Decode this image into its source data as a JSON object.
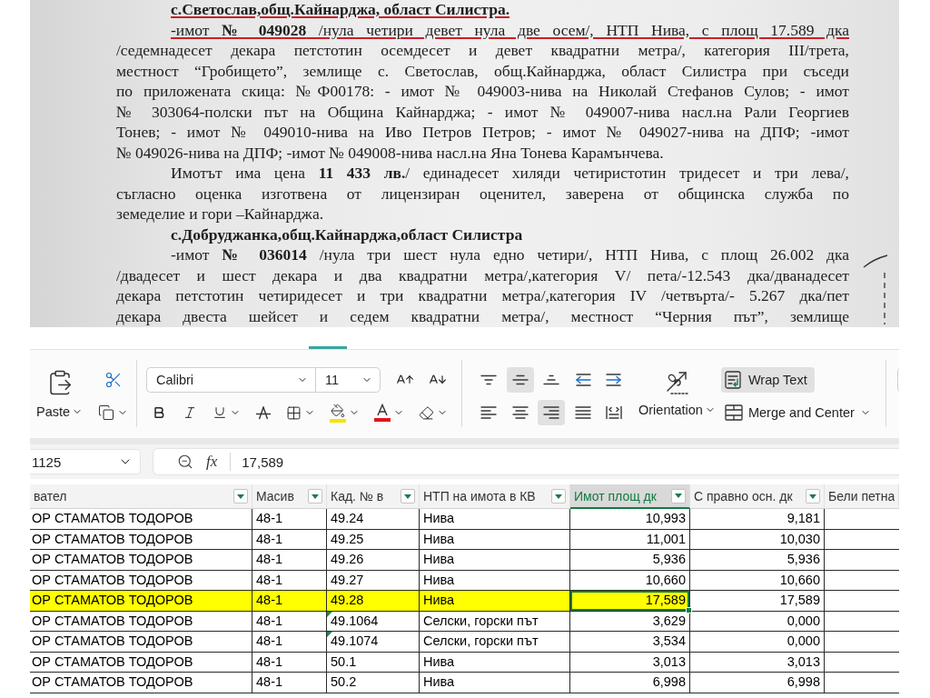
{
  "document": {
    "lines": [
      {
        "kind": "heading",
        "text": "с.Светослав,общ.Кайнарджа, област Силистра.",
        "underlined": true
      },
      {
        "kind": "first",
        "text": "-имот **№ 049028** /нула четири девет нула две осем/, НТП Нива, с площ 17.589 дка",
        "underlined": true
      },
      {
        "kind": "body",
        "text": "/седемнадесет декара петстотин осемдесет и девет квадратни метра/, категория III/трета,",
        "underlined": false
      },
      {
        "kind": "body",
        "text": "местност “Гробището”, землище с. Светослав, общ.Кайнарджа, област Силистра при съседи",
        "underlined": false
      },
      {
        "kind": "body",
        "text": "по приложената скица: №Ф00178: - имот № 049003-нива на Николай Стефанов Сулов; - имот",
        "underlined": false
      },
      {
        "kind": "body",
        "text": "№ 303064-полски път на Община Кайнарджа; - имот № 049007-нива насл.на Рали Георгиев",
        "underlined": false
      },
      {
        "kind": "body",
        "text": "Тонев; - имот № 049010-нива на Иво Петров Петров; - имот № 049027-нива на ДПФ; -имот",
        "underlined": false
      },
      {
        "kind": "last",
        "text": "№ 049026-нива на ДПФ; -имот № 049008-нива насл.на Яна Тонева Карамънчева.",
        "underlined": false
      },
      {
        "kind": "first",
        "text": "Имотът има цена **11 433 лв.**/ единадесет хиляди четиристотин тридесет и три лева/,",
        "underlined": false
      },
      {
        "kind": "body",
        "text": "съгласно оценка изготвена от лицензиран оценител, заверена от общинска служба по",
        "underlined": false
      },
      {
        "kind": "last",
        "text": "земеделие и гори –Кайнарджа.",
        "underlined": false
      },
      {
        "kind": "heading",
        "text": "с.Добруджанка,общ.Кайнарджа,област Силистра",
        "underlined": false
      },
      {
        "kind": "first",
        "text": "-имот **№ 036014** /нула три шест нула едно четири/, НТП Нива, с площ 26.002 дка",
        "underlined": false
      },
      {
        "kind": "body",
        "text": "/двадесет и шест декара и два квадратни метра/,категория V/ пета/-12.543 дка/дванадесет",
        "underlined": false
      },
      {
        "kind": "body",
        "text": "декара петстотин четиридесет и три квадратни метра/,категория IV /четвърта/- 5.267 дка/пет",
        "underlined": false
      },
      {
        "kind": "body",
        "text": "декара двеста шейсет и седем квадратни метра/, местност “Черния път”, землище",
        "underlined": false
      }
    ]
  },
  "ribbon": {
    "paste": {
      "label": "Paste"
    },
    "font": {
      "name": "Calibri",
      "size": "11"
    },
    "alignment": [
      {
        "kind": "top",
        "selected": false
      },
      {
        "kind": "middle",
        "selected": true
      },
      {
        "kind": "bottom",
        "selected": false
      },
      {
        "kind": "outdent",
        "selected": false
      },
      {
        "kind": "indent",
        "selected": false
      },
      {
        "kind": "left",
        "selected": false
      },
      {
        "kind": "center",
        "selected": false
      },
      {
        "kind": "right",
        "selected": true
      },
      {
        "kind": "justify",
        "selected": false
      },
      {
        "kind": "distributed",
        "selected": false
      }
    ],
    "orientation": {
      "label": "Orientation"
    },
    "wrap_text": {
      "label": "Wrap Text",
      "selected": true
    },
    "merge": {
      "label": "Merge and Center"
    }
  },
  "formula_bar": {
    "name_box": "1125",
    "function_button": "fx",
    "value": "17,589"
  },
  "table": {
    "columns": [
      {
        "label": "вател",
        "kind": "text",
        "filter": true,
        "selected": false
      },
      {
        "label": "Масив",
        "kind": "text",
        "filter": true,
        "selected": false
      },
      {
        "label": "Кад. № в",
        "kind": "text",
        "filter": true,
        "selected": false
      },
      {
        "label": "НТП на имота в КВ",
        "kind": "text",
        "filter": true,
        "selected": false
      },
      {
        "label": "Имот площ дк",
        "kind": "number",
        "filter": true,
        "selected": true
      },
      {
        "label": "С правно осн. дк",
        "kind": "number",
        "filter": true,
        "selected": false
      },
      {
        "label": "Бели петна",
        "filter": false,
        "selected": false
      }
    ],
    "rows": [
      {
        "cells": [
          {
            "text": "ОР СТАМАТОВ ТОДОРОВ",
            "highlighted": false,
            "flagged": false,
            "selected": false
          },
          {
            "text": "48-1",
            "highlighted": false,
            "flagged": false,
            "selected": false
          },
          {
            "text": "49.24",
            "highlighted": false,
            "flagged": false,
            "selected": false
          },
          {
            "text": "Нива",
            "highlighted": false,
            "flagged": false,
            "selected": false
          },
          {
            "text": "10,993",
            "highlighted": false,
            "flagged": false,
            "selected": false
          },
          {
            "text": "9,181",
            "highlighted": false,
            "flagged": false,
            "selected": false
          }
        ]
      },
      {
        "cells": [
          {
            "text": "ОР СТАМАТОВ ТОДОРОВ",
            "highlighted": false,
            "flagged": false,
            "selected": false
          },
          {
            "text": "48-1",
            "highlighted": false,
            "flagged": false,
            "selected": false
          },
          {
            "text": "49.25",
            "highlighted": false,
            "flagged": false,
            "selected": false
          },
          {
            "text": "Нива",
            "highlighted": false,
            "flagged": false,
            "selected": false
          },
          {
            "text": "11,001",
            "highlighted": false,
            "flagged": false,
            "selected": false
          },
          {
            "text": "10,030",
            "highlighted": false,
            "flagged": false,
            "selected": false
          }
        ]
      },
      {
        "cells": [
          {
            "text": "ОР СТАМАТОВ ТОДОРОВ",
            "highlighted": false,
            "flagged": false,
            "selected": false
          },
          {
            "text": "48-1",
            "highlighted": false,
            "flagged": false,
            "selected": false
          },
          {
            "text": "49.26",
            "highlighted": false,
            "flagged": false,
            "selected": false
          },
          {
            "text": "Нива",
            "highlighted": false,
            "flagged": false,
            "selected": false
          },
          {
            "text": "5,936",
            "highlighted": false,
            "flagged": false,
            "selected": false
          },
          {
            "text": "5,936",
            "highlighted": false,
            "flagged": false,
            "selected": false
          }
        ]
      },
      {
        "cells": [
          {
            "text": "ОР СТАМАТОВ ТОДОРОВ",
            "highlighted": false,
            "flagged": false,
            "selected": false
          },
          {
            "text": "48-1",
            "highlighted": false,
            "flagged": false,
            "selected": false
          },
          {
            "text": "49.27",
            "highlighted": false,
            "flagged": false,
            "selected": false
          },
          {
            "text": "Нива",
            "highlighted": false,
            "flagged": false,
            "selected": false
          },
          {
            "text": "10,660",
            "highlighted": false,
            "flagged": false,
            "selected": false
          },
          {
            "text": "10,660",
            "highlighted": false,
            "flagged": false,
            "selected": false
          }
        ]
      },
      {
        "cells": [
          {
            "text": "ОР СТАМАТОВ ТОДОРОВ",
            "highlighted": true,
            "flagged": false,
            "selected": false
          },
          {
            "text": "48-1",
            "highlighted": true,
            "flagged": false,
            "selected": false
          },
          {
            "text": "49.28",
            "highlighted": true,
            "flagged": false,
            "selected": false
          },
          {
            "text": "Нива",
            "highlighted": true,
            "flagged": false,
            "selected": false
          },
          {
            "text": "17,589",
            "highlighted": true,
            "flagged": false,
            "selected": true
          },
          {
            "text": "17,589",
            "highlighted": false,
            "flagged": false,
            "selected": false
          }
        ]
      },
      {
        "cells": [
          {
            "text": "ОР СТАМАТОВ ТОДОРОВ",
            "highlighted": false,
            "flagged": false,
            "selected": false
          },
          {
            "text": "48-1",
            "highlighted": false,
            "flagged": false,
            "selected": false
          },
          {
            "text": "49.1064",
            "highlighted": false,
            "flagged": true,
            "selected": false
          },
          {
            "text": "Селски, горски път",
            "highlighted": false,
            "flagged": false,
            "selected": false
          },
          {
            "text": "3,629",
            "highlighted": false,
            "flagged": false,
            "selected": false
          },
          {
            "text": "0,000",
            "highlighted": false,
            "flagged": false,
            "selected": false
          }
        ]
      },
      {
        "cells": [
          {
            "text": "ОР СТАМАТОВ ТОДОРОВ",
            "highlighted": false,
            "flagged": false,
            "selected": false
          },
          {
            "text": "48-1",
            "highlighted": false,
            "flagged": false,
            "selected": false
          },
          {
            "text": "49.1074",
            "highlighted": false,
            "flagged": true,
            "selected": false
          },
          {
            "text": "Селски, горски път",
            "highlighted": false,
            "flagged": false,
            "selected": false
          },
          {
            "text": "3,534",
            "highlighted": false,
            "flagged": false,
            "selected": false
          },
          {
            "text": "0,000",
            "highlighted": false,
            "flagged": false,
            "selected": false
          }
        ]
      },
      {
        "cells": [
          {
            "text": "ОР СТАМАТОВ ТОДОРОВ",
            "highlighted": false,
            "flagged": false,
            "selected": false
          },
          {
            "text": "48-1",
            "highlighted": false,
            "flagged": false,
            "selected": false
          },
          {
            "text": "50.1",
            "highlighted": false,
            "flagged": false,
            "selected": false
          },
          {
            "text": "Нива",
            "highlighted": false,
            "flagged": false,
            "selected": false
          },
          {
            "text": "3,013",
            "highlighted": false,
            "flagged": false,
            "selected": false
          },
          {
            "text": "3,013",
            "highlighted": false,
            "flagged": false,
            "selected": false
          }
        ]
      },
      {
        "cells": [
          {
            "text": "ОР СТАМАТОВ ТОДОРОВ",
            "highlighted": false,
            "flagged": false,
            "selected": false
          },
          {
            "text": "48-1",
            "highlighted": false,
            "flagged": false,
            "selected": false
          },
          {
            "text": "50.2",
            "highlighted": false,
            "flagged": false,
            "selected": false
          },
          {
            "text": "Нива",
            "highlighted": false,
            "flagged": false,
            "selected": false
          },
          {
            "text": "6,998",
            "highlighted": false,
            "flagged": false,
            "selected": false
          },
          {
            "text": "6,998",
            "highlighted": false,
            "flagged": false,
            "selected": false
          }
        ]
      }
    ]
  }
}
